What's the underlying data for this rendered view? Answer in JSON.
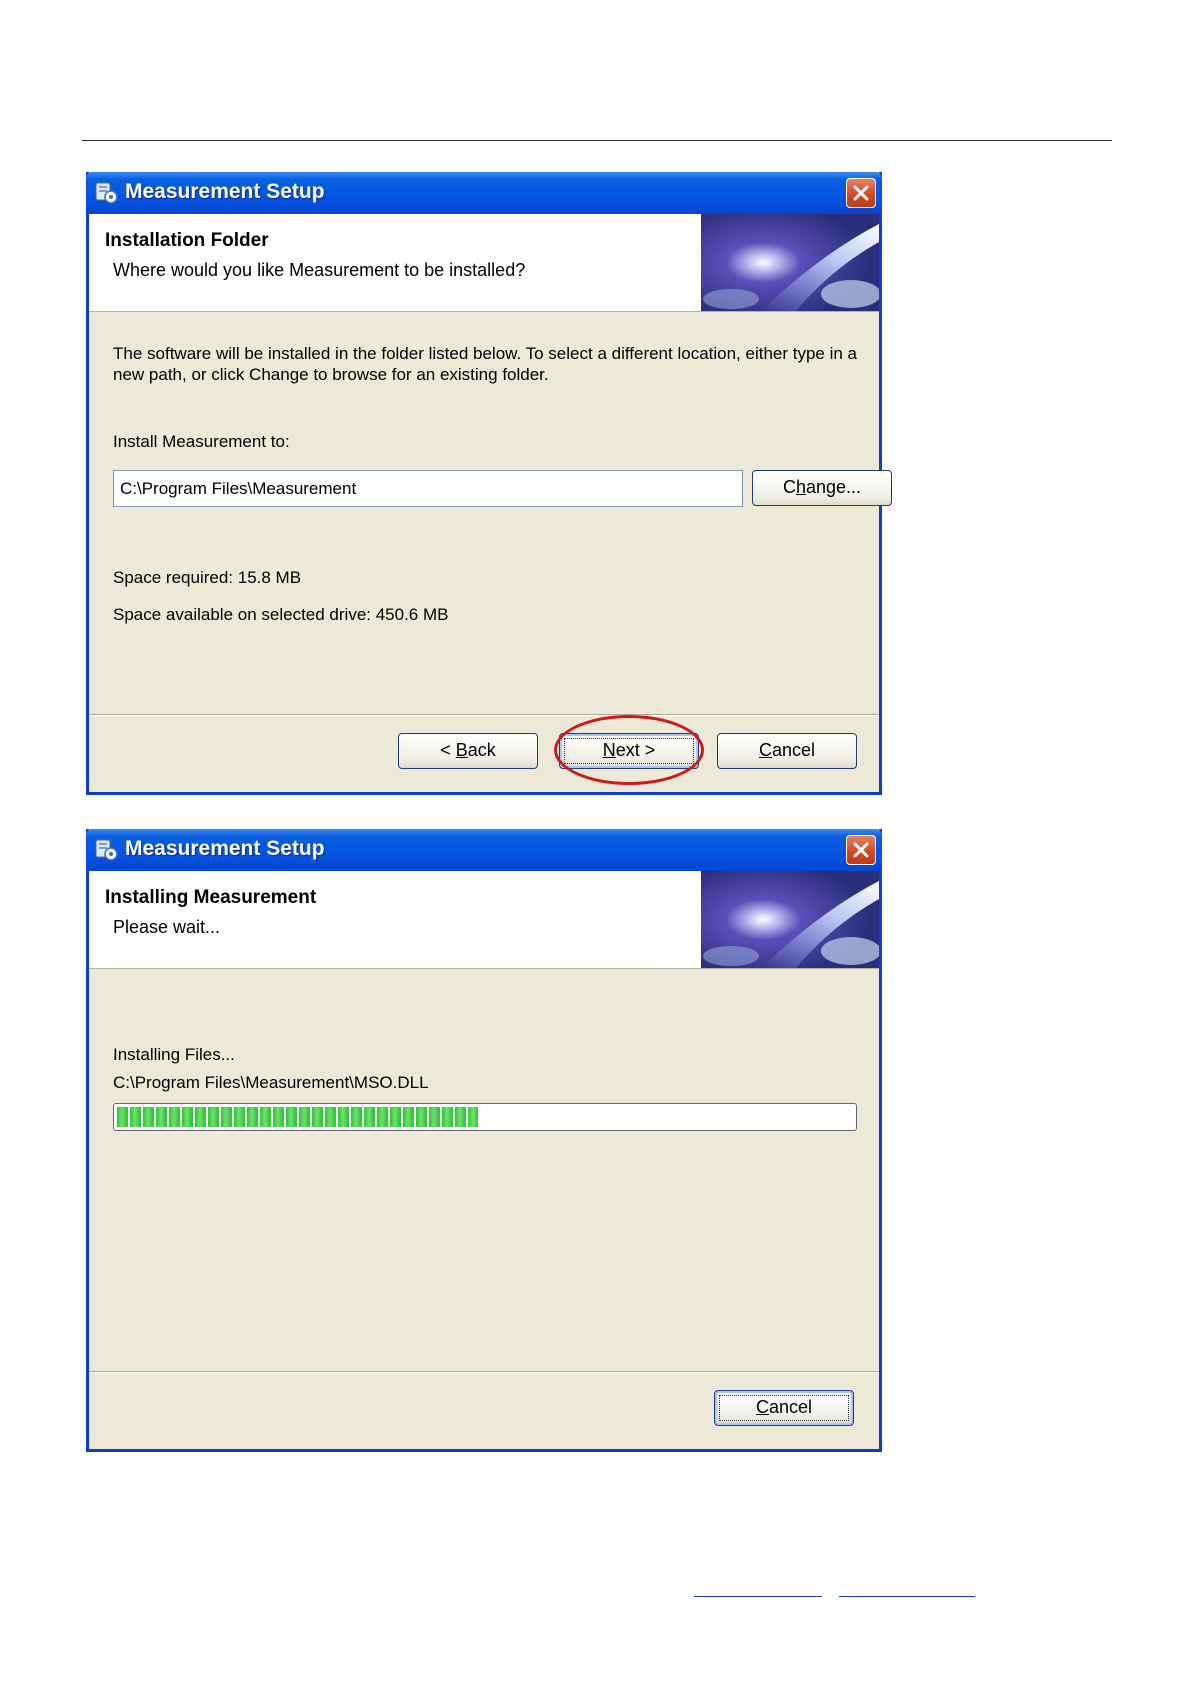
{
  "dialog1": {
    "title": "Measurement Setup",
    "header_title": "Installation Folder",
    "header_subtitle": "Where would you like Measurement to be installed?",
    "description_line1": "The software will be installed in the folder listed below. To select a different location, either type in a",
    "description_line2": "new path, or click Change to browse for an existing folder.",
    "install_label": "Install Measurement to:",
    "install_path": "C:\\Program Files\\Measurement",
    "change_button": {
      "pre": "C",
      "mnemonic": "h",
      "post": "ange..."
    },
    "space_required": "Space required: 15.8 MB",
    "space_available": "Space available on selected drive: 450.6 MB",
    "back_button": {
      "pre": "< ",
      "mnemonic": "B",
      "post": "ack"
    },
    "next_button": {
      "pre": "",
      "mnemonic": "N",
      "post": "ext >"
    },
    "cancel_button": {
      "pre": "",
      "mnemonic": "C",
      "post": "ancel"
    }
  },
  "dialog2": {
    "title": "Measurement Setup",
    "header_title": "Installing Measurement",
    "header_subtitle": "Please wait...",
    "status_label": "Installing Files...",
    "current_file": "C:\\Program Files\\Measurement\\MSO.DLL",
    "progress_fraction": 0.49,
    "cancel_button": {
      "pre": "",
      "mnemonic": "C",
      "post": "ancel"
    }
  },
  "colors": {
    "titlebar": "#0554e2",
    "dialog_bg": "#ece9d8",
    "progress_green": "#2fc53a",
    "highlight_red": "#d01818"
  },
  "icons": [
    "setup-app-icon",
    "close-icon",
    "banner-image"
  ]
}
